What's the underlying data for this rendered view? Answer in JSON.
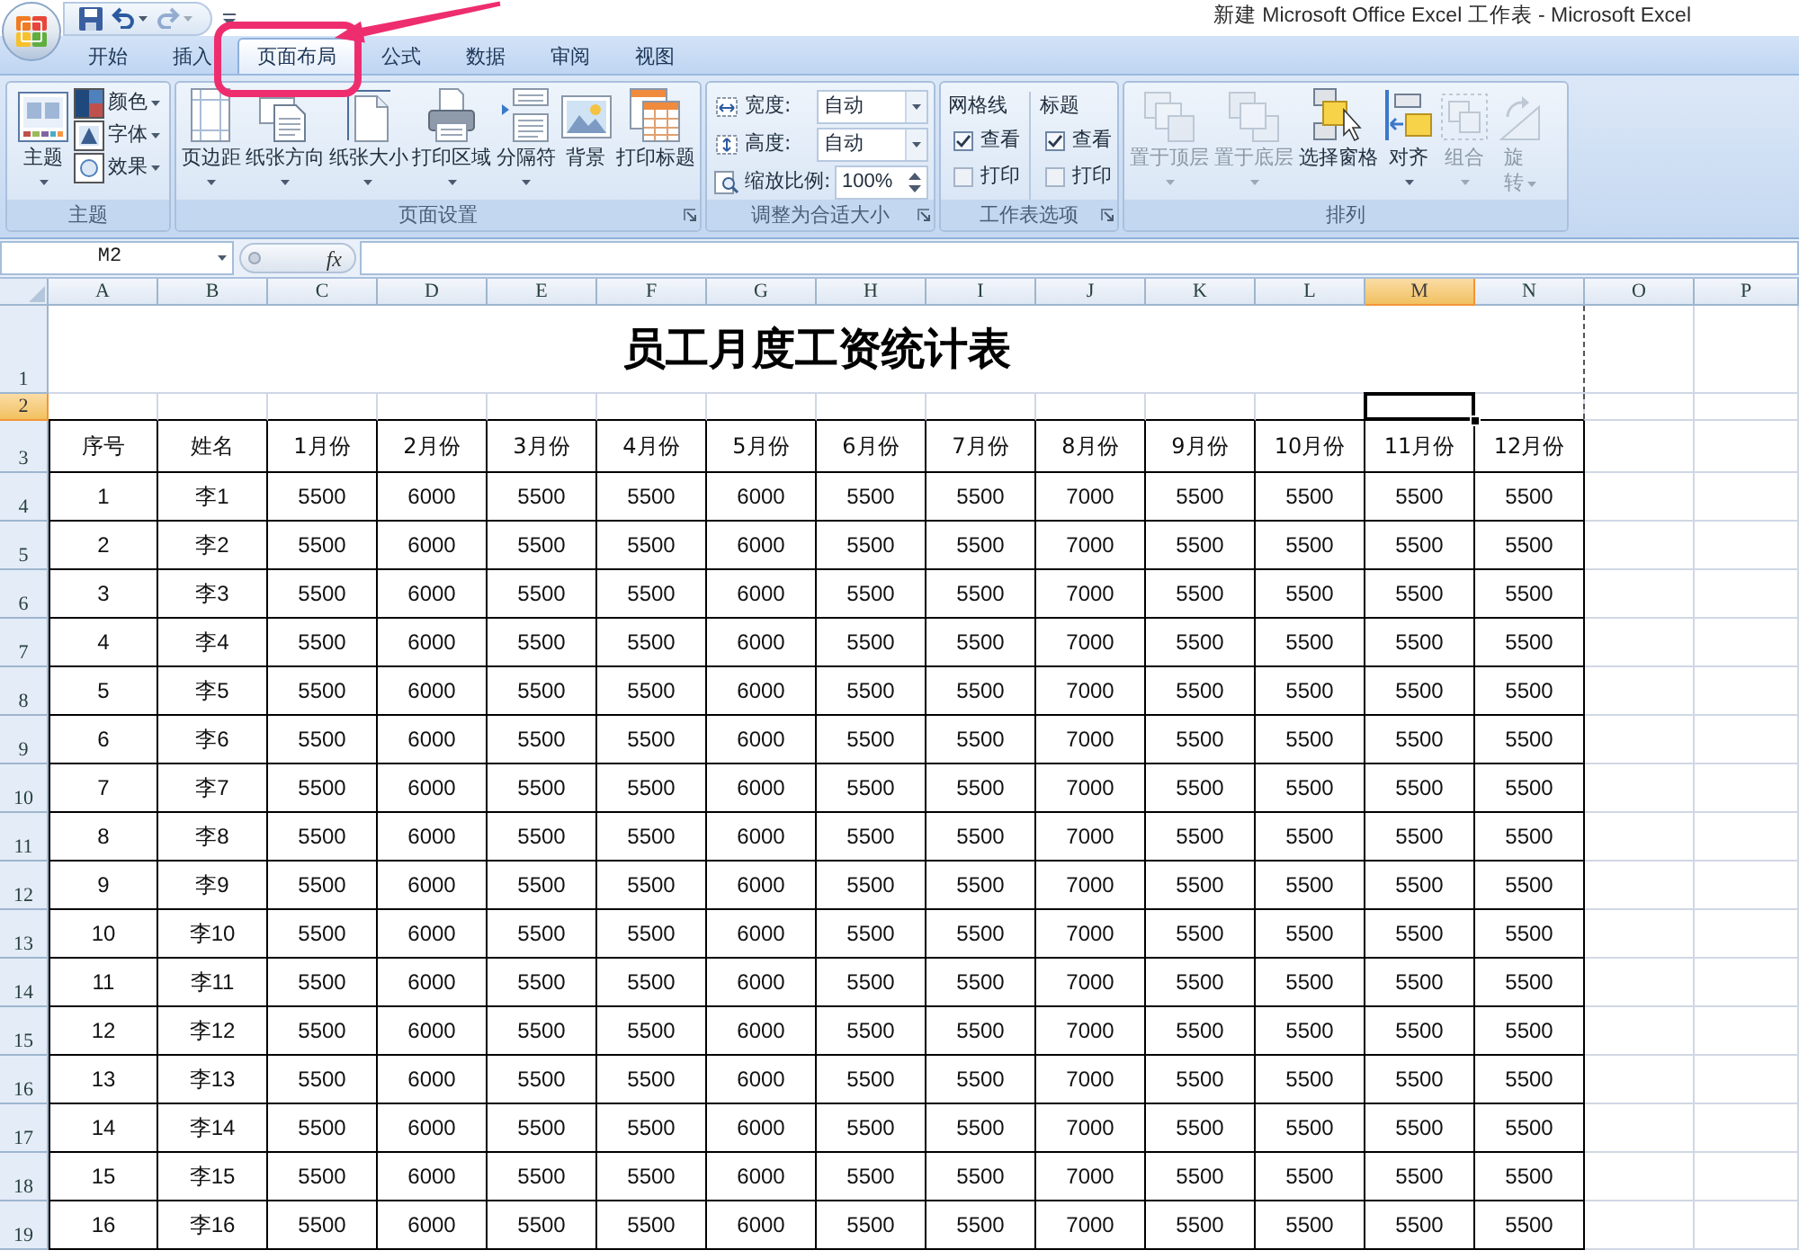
{
  "window": {
    "title": "新建 Microsoft Office Excel 工作表 - Microsoft Excel"
  },
  "quick_access": [
    {
      "kind": "save",
      "disabled": false
    },
    {
      "kind": "undo",
      "disabled": false
    },
    {
      "kind": "redo",
      "disabled": true
    }
  ],
  "tabs": [
    {
      "label": "开始",
      "selected": false
    },
    {
      "label": "插入",
      "selected": false
    },
    {
      "label": "页面布局",
      "selected": true
    },
    {
      "label": "公式",
      "selected": false
    },
    {
      "label": "数据",
      "selected": false
    },
    {
      "label": "审阅",
      "selected": false
    },
    {
      "label": "视图",
      "selected": false
    }
  ],
  "ribbon": {
    "groups": [
      {
        "kind": "theme",
        "label": "主题",
        "launcher": false,
        "main": {
          "label": "主题",
          "menu": true
        },
        "items": [
          {
            "kind": "colors",
            "label": "颜色",
            "menu": true
          },
          {
            "kind": "fonts",
            "label": "字体",
            "menu": true
          },
          {
            "kind": "effects",
            "label": "效果",
            "menu": true
          }
        ]
      },
      {
        "kind": "buttons",
        "label": "页面设置",
        "launcher": true,
        "buttons": [
          {
            "kind": "margins",
            "label": "页边距",
            "menu": true,
            "disabled": false
          },
          {
            "kind": "orientation",
            "label": "纸张方向",
            "menu": true,
            "disabled": false
          },
          {
            "kind": "size",
            "label": "纸张大小",
            "menu": true,
            "disabled": false
          },
          {
            "kind": "print_area",
            "label": "打印区域",
            "menu": true,
            "disabled": false
          },
          {
            "kind": "breaks",
            "label": "分隔符",
            "menu": true,
            "disabled": false
          },
          {
            "kind": "background",
            "label": "背景",
            "menu": false,
            "disabled": false
          },
          {
            "kind": "print_titles",
            "label": "打印标题",
            "menu": false,
            "disabled": false
          }
        ]
      },
      {
        "kind": "scale",
        "label": "调整为合适大小",
        "launcher": true,
        "fields": [
          {
            "kind": "width",
            "label": "宽度:",
            "value": "自动"
          },
          {
            "kind": "height",
            "label": "高度:",
            "value": "自动"
          },
          {
            "kind": "scale",
            "label": "缩放比例:",
            "value": "100%"
          }
        ]
      },
      {
        "kind": "options",
        "label": "工作表选项",
        "launcher": true,
        "columns": [
          {
            "title": "网格线",
            "options": [
              {
                "label": "查看",
                "checked": true
              },
              {
                "label": "打印",
                "checked": false
              }
            ]
          },
          {
            "title": "标题",
            "options": [
              {
                "label": "查看",
                "checked": true
              },
              {
                "label": "打印",
                "checked": false
              }
            ]
          }
        ]
      },
      {
        "kind": "buttons",
        "label": "排列",
        "launcher": false,
        "buttons": [
          {
            "kind": "front",
            "label": "置于顶层",
            "menu": true,
            "disabled": true
          },
          {
            "kind": "back",
            "label": "置于底层",
            "menu": true,
            "disabled": true
          },
          {
            "kind": "selection_pane",
            "label": "选择窗格",
            "menu": false,
            "disabled": false
          },
          {
            "kind": "align",
            "label": "对齐",
            "menu": true,
            "disabled": false
          },
          {
            "kind": "group",
            "label": "组合",
            "menu": true,
            "disabled": true
          },
          {
            "kind": "rotate",
            "label": "旋转",
            "menu": true,
            "disabled": true
          }
        ]
      }
    ]
  },
  "formula_bar": {
    "name_box": "M2",
    "function_button": "fx"
  },
  "sheet": {
    "columns": [
      {
        "label": "A",
        "selected": false
      },
      {
        "label": "B",
        "selected": false
      },
      {
        "label": "C",
        "selected": false
      },
      {
        "label": "D",
        "selected": false
      },
      {
        "label": "E",
        "selected": false
      },
      {
        "label": "F",
        "selected": false
      },
      {
        "label": "G",
        "selected": false
      },
      {
        "label": "H",
        "selected": false
      },
      {
        "label": "I",
        "selected": false
      },
      {
        "label": "J",
        "selected": false
      },
      {
        "label": "K",
        "selected": false
      },
      {
        "label": "L",
        "selected": false
      },
      {
        "label": "M",
        "selected": true
      },
      {
        "label": "N",
        "selected": false
      },
      {
        "label": "O",
        "selected": false
      },
      {
        "label": "P",
        "selected": false
      }
    ],
    "rows": [
      {
        "label": "1",
        "selected": false
      },
      {
        "label": "2",
        "selected": true
      },
      {
        "label": "3",
        "selected": false
      },
      {
        "label": "4",
        "selected": false
      },
      {
        "label": "5",
        "selected": false
      },
      {
        "label": "6",
        "selected": false
      },
      {
        "label": "7",
        "selected": false
      },
      {
        "label": "8",
        "selected": false
      },
      {
        "label": "9",
        "selected": false
      },
      {
        "label": "10",
        "selected": false
      },
      {
        "label": "11",
        "selected": false
      },
      {
        "label": "12",
        "selected": false
      },
      {
        "label": "13",
        "selected": false
      },
      {
        "label": "14",
        "selected": false
      },
      {
        "label": "15",
        "selected": false
      },
      {
        "label": "16",
        "selected": false
      },
      {
        "label": "17",
        "selected": false
      },
      {
        "label": "18",
        "selected": false
      },
      {
        "label": "19",
        "selected": false
      }
    ],
    "title": "员工月度工资统计表",
    "header": [
      "序号",
      "姓名",
      "1月份",
      "2月份",
      "3月份",
      "4月份",
      "5月份",
      "6月份",
      "7月份",
      "8月份",
      "9月份",
      "10月份",
      "11月份",
      "12月份"
    ],
    "data": [
      [
        "1",
        "李1",
        "5500",
        "6000",
        "5500",
        "5500",
        "6000",
        "5500",
        "5500",
        "7000",
        "5500",
        "5500",
        "5500",
        "5500"
      ],
      [
        "2",
        "李2",
        "5500",
        "6000",
        "5500",
        "5500",
        "6000",
        "5500",
        "5500",
        "7000",
        "5500",
        "5500",
        "5500",
        "5500"
      ],
      [
        "3",
        "李3",
        "5500",
        "6000",
        "5500",
        "5500",
        "6000",
        "5500",
        "5500",
        "7000",
        "5500",
        "5500",
        "5500",
        "5500"
      ],
      [
        "4",
        "李4",
        "5500",
        "6000",
        "5500",
        "5500",
        "6000",
        "5500",
        "5500",
        "7000",
        "5500",
        "5500",
        "5500",
        "5500"
      ],
      [
        "5",
        "李5",
        "5500",
        "6000",
        "5500",
        "5500",
        "6000",
        "5500",
        "5500",
        "7000",
        "5500",
        "5500",
        "5500",
        "5500"
      ],
      [
        "6",
        "李6",
        "5500",
        "6000",
        "5500",
        "5500",
        "6000",
        "5500",
        "5500",
        "7000",
        "5500",
        "5500",
        "5500",
        "5500"
      ],
      [
        "7",
        "李7",
        "5500",
        "6000",
        "5500",
        "5500",
        "6000",
        "5500",
        "5500",
        "7000",
        "5500",
        "5500",
        "5500",
        "5500"
      ],
      [
        "8",
        "李8",
        "5500",
        "6000",
        "5500",
        "5500",
        "6000",
        "5500",
        "5500",
        "7000",
        "5500",
        "5500",
        "5500",
        "5500"
      ],
      [
        "9",
        "李9",
        "5500",
        "6000",
        "5500",
        "5500",
        "6000",
        "5500",
        "5500",
        "7000",
        "5500",
        "5500",
        "5500",
        "5500"
      ],
      [
        "10",
        "李10",
        "5500",
        "6000",
        "5500",
        "5500",
        "6000",
        "5500",
        "5500",
        "7000",
        "5500",
        "5500",
        "5500",
        "5500"
      ],
      [
        "11",
        "李11",
        "5500",
        "6000",
        "5500",
        "5500",
        "6000",
        "5500",
        "5500",
        "7000",
        "5500",
        "5500",
        "5500",
        "5500"
      ],
      [
        "12",
        "李12",
        "5500",
        "6000",
        "5500",
        "5500",
        "6000",
        "5500",
        "5500",
        "7000",
        "5500",
        "5500",
        "5500",
        "5500"
      ],
      [
        "13",
        "李13",
        "5500",
        "6000",
        "5500",
        "5500",
        "6000",
        "5500",
        "5500",
        "7000",
        "5500",
        "5500",
        "5500",
        "5500"
      ],
      [
        "14",
        "李14",
        "5500",
        "6000",
        "5500",
        "5500",
        "6000",
        "5500",
        "5500",
        "7000",
        "5500",
        "5500",
        "5500",
        "5500"
      ],
      [
        "15",
        "李15",
        "5500",
        "6000",
        "5500",
        "5500",
        "6000",
        "5500",
        "5500",
        "7000",
        "5500",
        "5500",
        "5500",
        "5500"
      ],
      [
        "16",
        "李16",
        "5500",
        "6000",
        "5500",
        "5500",
        "6000",
        "5500",
        "5500",
        "7000",
        "5500",
        "5500",
        "5500",
        "5500"
      ]
    ]
  }
}
